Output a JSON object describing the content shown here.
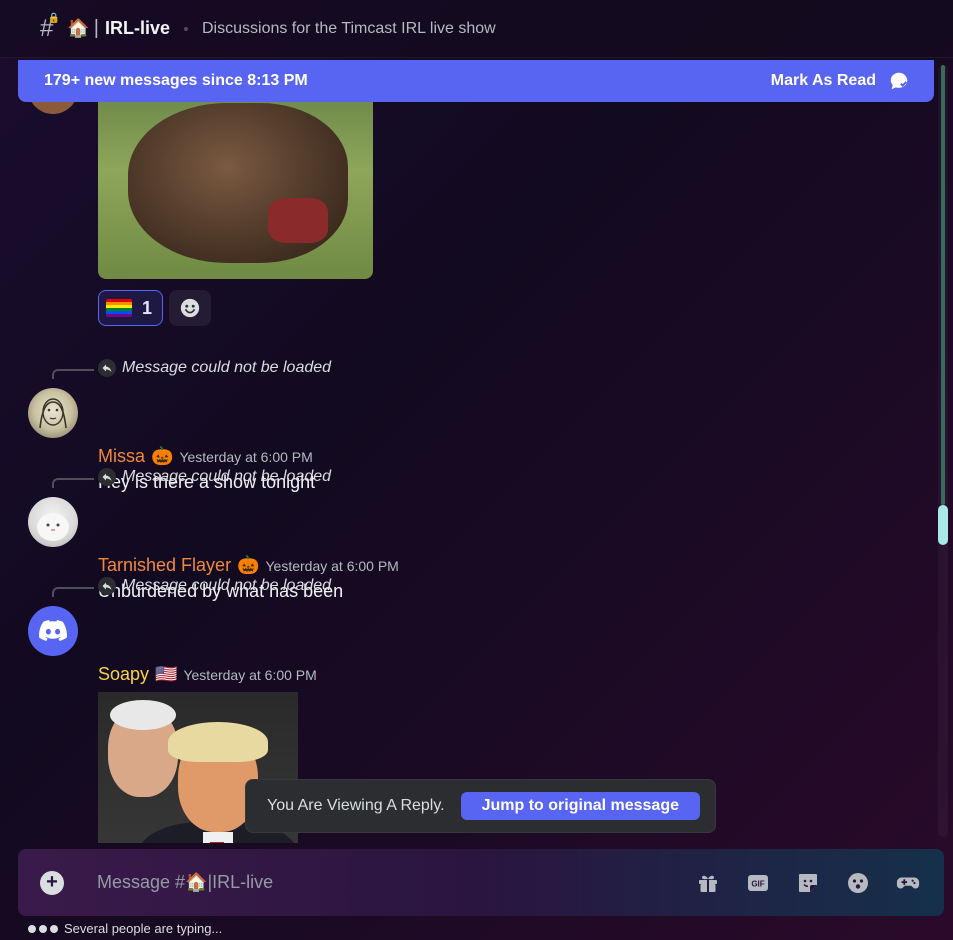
{
  "header": {
    "channel_emoji": "🏠",
    "channel_name": "IRL-live",
    "topic": "Discussions for the Timcast IRL live show"
  },
  "banner": {
    "new_messages": "179+ new messages since 8:13 PM",
    "mark_read": "Mark As Read"
  },
  "reactions": [
    {
      "emoji": "rainbow-flag",
      "count": "1"
    }
  ],
  "reply_unavailable": "Message could not be loaded",
  "messages": [
    {
      "username": "Missa",
      "badge": "🎃",
      "timestamp": "Yesterday at 6:00 PM",
      "text": "Hey is there a show tonight",
      "color": "#f0883e"
    },
    {
      "username": "Tarnished Flayer",
      "badge": "🎃",
      "timestamp": "Yesterday at 6:00 PM",
      "text": "Unburdened by what has been",
      "color": "#f0883e"
    },
    {
      "username": "Soapy",
      "badge": "🇺🇸",
      "timestamp": "Yesterday at 6:00 PM",
      "text": "",
      "color": "#f5d547"
    }
  ],
  "toast": {
    "label": "You Are Viewing A Reply.",
    "jump": "Jump to original message"
  },
  "composer": {
    "placeholder": "Message #🏠|IRL-live",
    "gif_label": "GIF"
  },
  "typing": "Several people are typing..."
}
